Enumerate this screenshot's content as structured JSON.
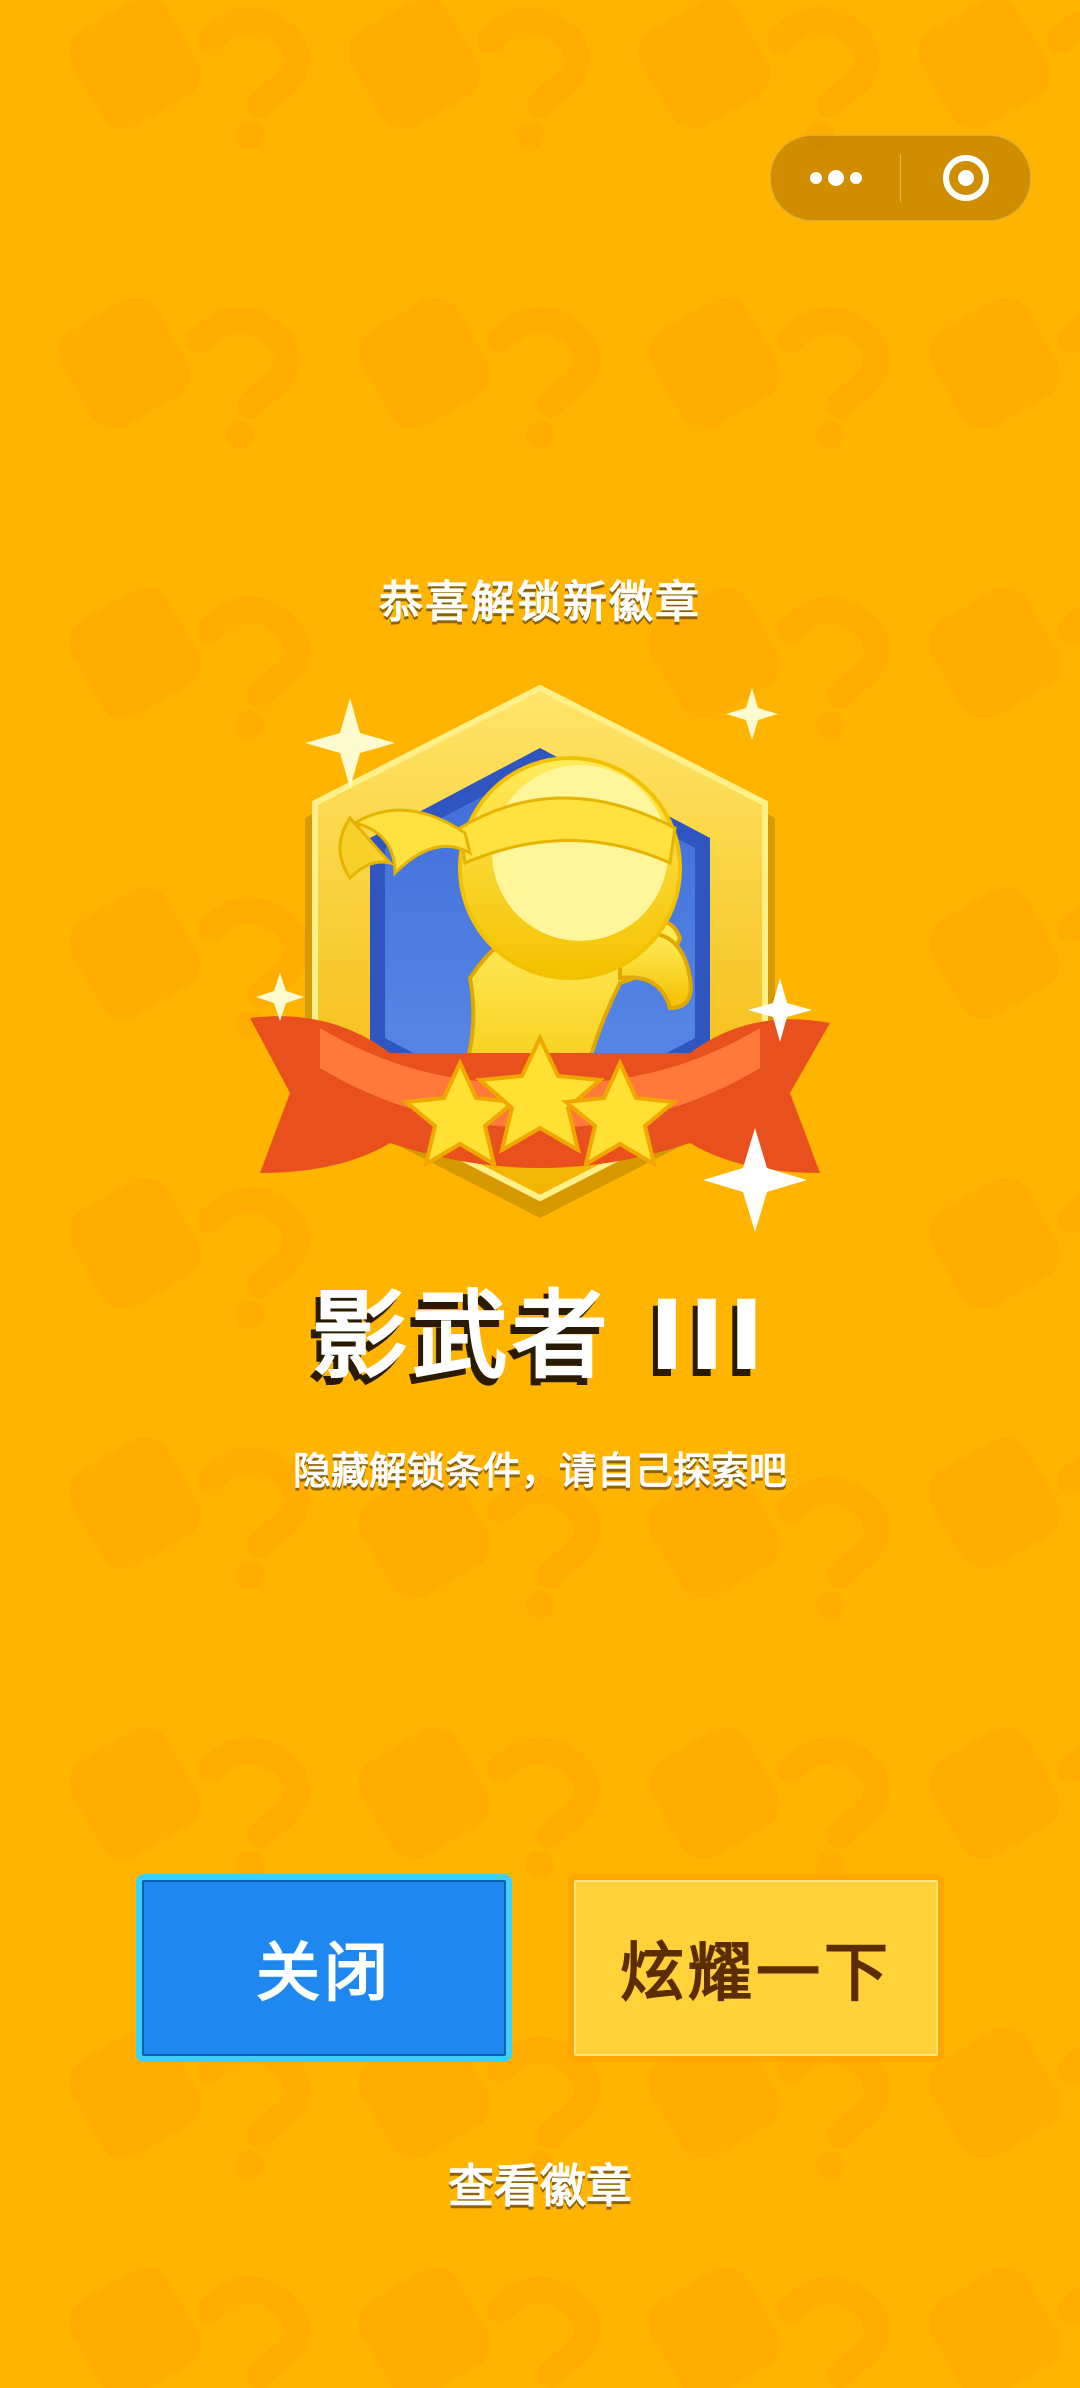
{
  "capsule": {
    "menu_icon": "more-dots-icon",
    "close_icon": "target-circle-icon"
  },
  "header": {
    "title": "恭喜解锁新徽章"
  },
  "badge": {
    "name": "影武者 III",
    "stars": 3,
    "icon": "ninja-hexagon-badge-icon"
  },
  "description": "隐藏解锁条件，请自己探索吧",
  "buttons": {
    "close_label": "关闭",
    "share_label": "炫耀一下"
  },
  "footer_link": "查看徽章",
  "colors": {
    "background": "#FFB400",
    "close_button": "#1E88F0",
    "share_button": "#FFD23A",
    "share_text": "#5C2D00"
  }
}
